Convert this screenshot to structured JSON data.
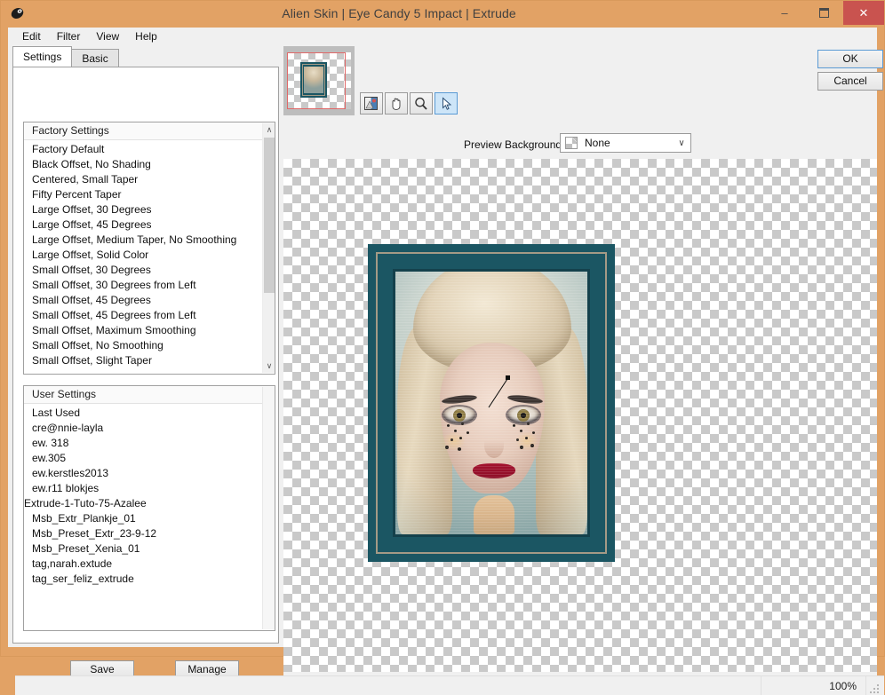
{
  "window": {
    "title": "Alien Skin | Eye Candy 5 Impact | Extrude",
    "app_icon": "alien-skin-icon",
    "minimize_glyph": "–",
    "maximize_glyph": "❐",
    "close_glyph": "✕",
    "frame_color": "#e2a265",
    "close_color": "#c9534f"
  },
  "menubar": {
    "items": [
      {
        "label": "Edit"
      },
      {
        "label": "Filter"
      },
      {
        "label": "View"
      },
      {
        "label": "Help"
      }
    ]
  },
  "tabs": [
    {
      "label": "Settings",
      "active": true
    },
    {
      "label": "Basic",
      "active": false
    }
  ],
  "factory_settings": {
    "header": "Factory Settings",
    "items": [
      "Factory Default",
      "Black Offset, No Shading",
      "Centered, Small Taper",
      "Fifty Percent Taper",
      "Large Offset, 30 Degrees",
      "Large Offset, 45 Degrees",
      "Large Offset, Medium Taper, No Smoothing",
      "Large Offset, Solid Color",
      "Small Offset, 30 Degrees",
      "Small Offset, 30 Degrees from Left",
      "Small Offset, 45 Degrees",
      "Small Offset, 45 Degrees from Left",
      "Small Offset, Maximum Smoothing",
      "Small Offset, No Smoothing",
      "Small Offset, Slight Taper"
    ],
    "scroll_up_glyph": "∧",
    "scroll_down_glyph": "∨"
  },
  "user_settings": {
    "header": "User Settings",
    "selected": "Extrude-1-Tuto-75-Azalee",
    "selection_color": "#1a7ee6",
    "items": [
      "Last Used",
      "cre@nnie-layla",
      "ew. 318",
      "ew.305",
      "ew.kerstles2013",
      "ew.r11 blokjes",
      "Extrude-1-Tuto-75-Azalee",
      "Msb_Extr_Plankje_01",
      "Msb_Preset_Extr_23-9-12",
      "Msb_Preset_Xenia_01",
      "tag,narah.extude",
      "tag_ser_feliz_extrude"
    ]
  },
  "preset_buttons": {
    "save": "Save",
    "manage": "Manage"
  },
  "dialog_buttons": {
    "ok": "OK",
    "cancel": "Cancel"
  },
  "toolbar": {
    "tools": [
      {
        "name": "before-after-preview-icon",
        "active": false
      },
      {
        "name": "hand-pan-icon",
        "active": false
      },
      {
        "name": "zoom-magnifier-icon",
        "active": false
      },
      {
        "name": "pointer-arrow-icon",
        "active": true
      }
    ],
    "preview_background": {
      "label": "Preview Background:",
      "value": "None",
      "swatch": "transparent-checker-swatch",
      "caret": "∨"
    }
  },
  "preview": {
    "background": "transparent-checkerboard",
    "checker_light": "#ffffff",
    "checker_dark": "#c9c9c9",
    "artwork": {
      "name": "framed-portrait",
      "frame_color": "#1b5663",
      "frame_inner_color": "#14414c",
      "bevel_color": "#a49a86",
      "handle": "extrude-direction-handle"
    }
  },
  "thumbnail": {
    "name": "navigator-thumbnail",
    "roi_color": "#e06868"
  },
  "statusbar": {
    "message": "",
    "zoom": "100%",
    "grip": "resize-grip"
  }
}
